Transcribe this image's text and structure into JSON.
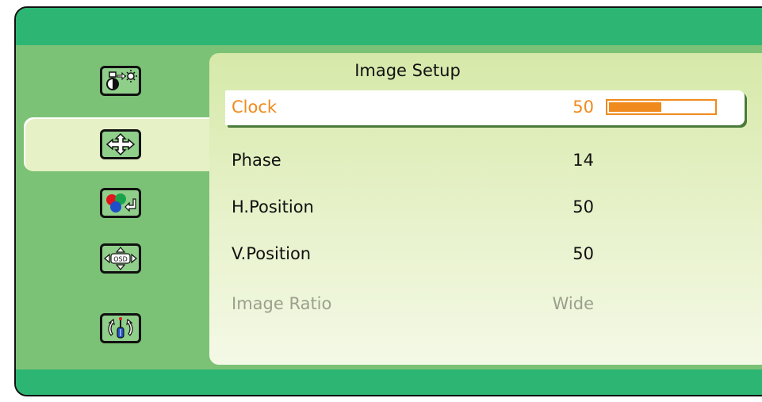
{
  "menu": {
    "title": "Image Setup",
    "items": [
      {
        "label": "Clock",
        "value": "50",
        "state": "selected",
        "level": 0.5
      },
      {
        "label": "Phase",
        "value": "14",
        "state": "normal"
      },
      {
        "label": "H.Position",
        "value": "50",
        "state": "normal"
      },
      {
        "label": "V.Position",
        "value": "50",
        "state": "normal"
      },
      {
        "label": "Image Ratio",
        "value": "Wide",
        "state": "disabled"
      }
    ]
  },
  "sidebar": {
    "icons": [
      {
        "name": "picture-settings-icon",
        "selected": false
      },
      {
        "name": "image-setup-icon",
        "selected": true
      },
      {
        "name": "color-settings-icon",
        "selected": false
      },
      {
        "name": "osd-settings-icon",
        "selected": false
      },
      {
        "name": "system-settings-icon",
        "selected": false
      }
    ]
  },
  "colors": {
    "bar": "#2db574",
    "sidebar": "#7cc276",
    "accent": "#f08a1c",
    "disabled_text": "#9aa08c"
  }
}
